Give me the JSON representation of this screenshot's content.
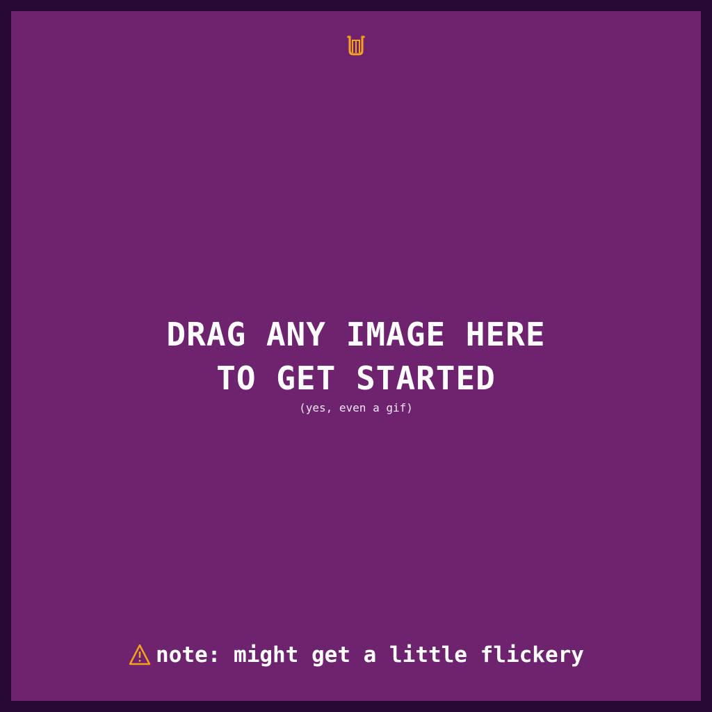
{
  "colors": {
    "background_outer": "#2a0836",
    "background_main": "#6d236e",
    "accent": "#f7a21b",
    "text": "#ffffff"
  },
  "header": {
    "logo_icon": "harp-icon"
  },
  "drop_zone": {
    "line1": "DRAG ANY IMAGE HERE",
    "line2": "TO GET STARTED",
    "subtext": "(yes, even a gif)"
  },
  "footer": {
    "warning_icon": "warning-triangle-icon",
    "note": "note: might get a little flickery"
  }
}
